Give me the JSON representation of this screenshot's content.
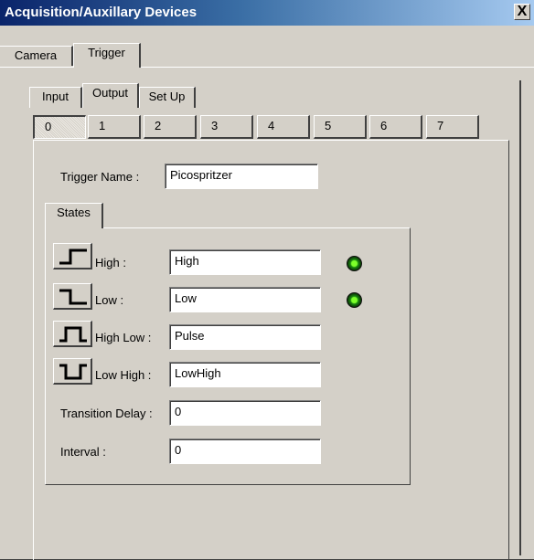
{
  "window": {
    "title": "Acquisition/Auxillary Devices",
    "close_label": "X"
  },
  "main_tabs": [
    {
      "label": "Camera"
    },
    {
      "label": "Trigger"
    }
  ],
  "sub_tabs": [
    {
      "label": "Input"
    },
    {
      "label": "Output"
    },
    {
      "label": "Set Up"
    }
  ],
  "channels": [
    "0",
    "1",
    "2",
    "3",
    "4",
    "5",
    "6",
    "7"
  ],
  "selected_channel": "0",
  "trigger": {
    "name_label": "Trigger Name :",
    "name_value": "Picospritzer"
  },
  "states_tab": {
    "label": "States"
  },
  "states": [
    {
      "label": "High :",
      "value": "High",
      "icon": "rising-edge-icon",
      "indicator": "on"
    },
    {
      "label": "Low :",
      "value": "Low",
      "icon": "falling-edge-icon",
      "indicator": "on"
    },
    {
      "label": "High Low :",
      "value": "Pulse",
      "icon": "positive-pulse-icon"
    },
    {
      "label": "Low High :",
      "value": "LowHigh",
      "icon": "negative-pulse-icon"
    }
  ],
  "transition_delay": {
    "label": "Transition Delay :",
    "value": "0"
  },
  "interval": {
    "label": "Interval :",
    "value": "0"
  },
  "colors": {
    "title_start": "#0a246a",
    "title_end": "#a6caf0",
    "face": "#d4d0c8",
    "led_on": "#39d418"
  }
}
